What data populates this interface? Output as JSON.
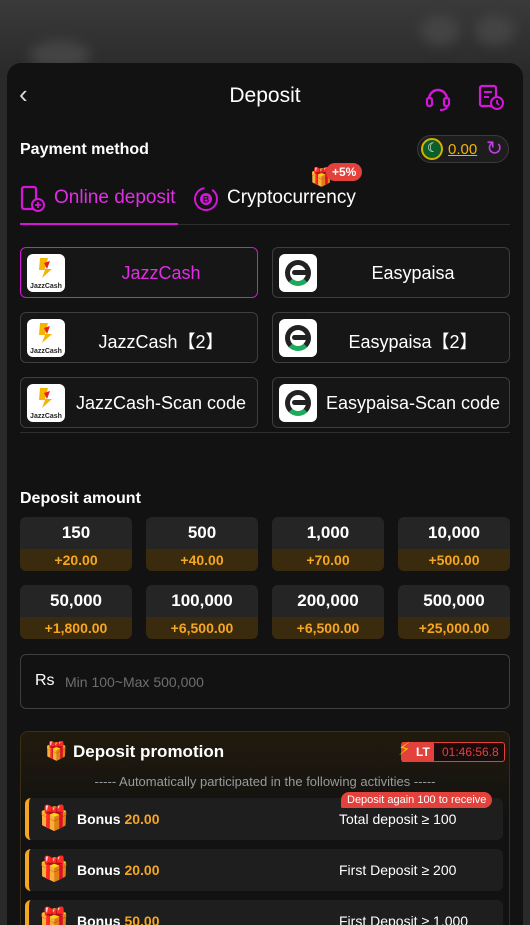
{
  "header": {
    "title": "Deposit",
    "back_icon": "chevron-left-icon",
    "support_icon": "headset-icon",
    "history_icon": "history-icon"
  },
  "payment": {
    "label": "Payment method",
    "balance": "0.00",
    "flag_icon": "pakistan-flag-icon",
    "refresh_icon": "refresh-icon"
  },
  "tabs": [
    {
      "label": "Online deposit",
      "icon": "phone-deposit-icon",
      "active": true
    },
    {
      "label": "Cryptocurrency",
      "icon": "bitcoin-icon",
      "active": false,
      "badge": "+5%"
    }
  ],
  "methods": [
    {
      "label": "JazzCash",
      "logo": "jazzcash",
      "selected": true
    },
    {
      "label": "Easypaisa",
      "logo": "easypaisa",
      "selected": false
    },
    {
      "label": "JazzCash【2】",
      "logo": "jazzcash",
      "selected": false
    },
    {
      "label": "Easypaisa【2】",
      "logo": "easypaisa",
      "selected": false
    },
    {
      "label": "JazzCash-Scan code",
      "logo": "jazzcash",
      "selected": false
    },
    {
      "label": "Easypaisa-Scan code",
      "logo": "easypaisa",
      "selected": false
    }
  ],
  "jazzcash_logo_text": "JazzCash",
  "deposit_amount": {
    "label": "Deposit amount",
    "options": [
      {
        "value": "150",
        "bonus": "+20.00"
      },
      {
        "value": "500",
        "bonus": "+40.00"
      },
      {
        "value": "1,000",
        "bonus": "+70.00"
      },
      {
        "value": "10,000",
        "bonus": "+500.00"
      },
      {
        "value": "50,000",
        "bonus": "+1,800.00"
      },
      {
        "value": "100,000",
        "bonus": "+6,500.00"
      },
      {
        "value": "200,000",
        "bonus": "+6,500.00"
      },
      {
        "value": "500,000",
        "bonus": "+25,000.00"
      }
    ]
  },
  "amount_input": {
    "currency": "Rs",
    "placeholder": "Min 100~Max 500,000",
    "value": ""
  },
  "promotion": {
    "title": "Deposit promotion",
    "timer_label": "LT",
    "timer": "01:46:56.8",
    "subtitle": "----- Automatically participated in the following activities -----",
    "rows": [
      {
        "bonus_label": "Bonus",
        "bonus_value": "20.00",
        "condition": "Total deposit ≥ 100",
        "tag": "Deposit again 100 to receive"
      },
      {
        "bonus_label": "Bonus",
        "bonus_value": "20.00",
        "condition": "First Deposit ≥ 200",
        "tag": ""
      },
      {
        "bonus_label": "Bonus",
        "bonus_value": "50.00",
        "condition": "First Deposit ≥ 1,000",
        "tag": ""
      }
    ]
  },
  "colors": {
    "accent": "#d316d8",
    "bonus": "#f5a623",
    "alert": "#e2413c",
    "background": "#121212"
  }
}
